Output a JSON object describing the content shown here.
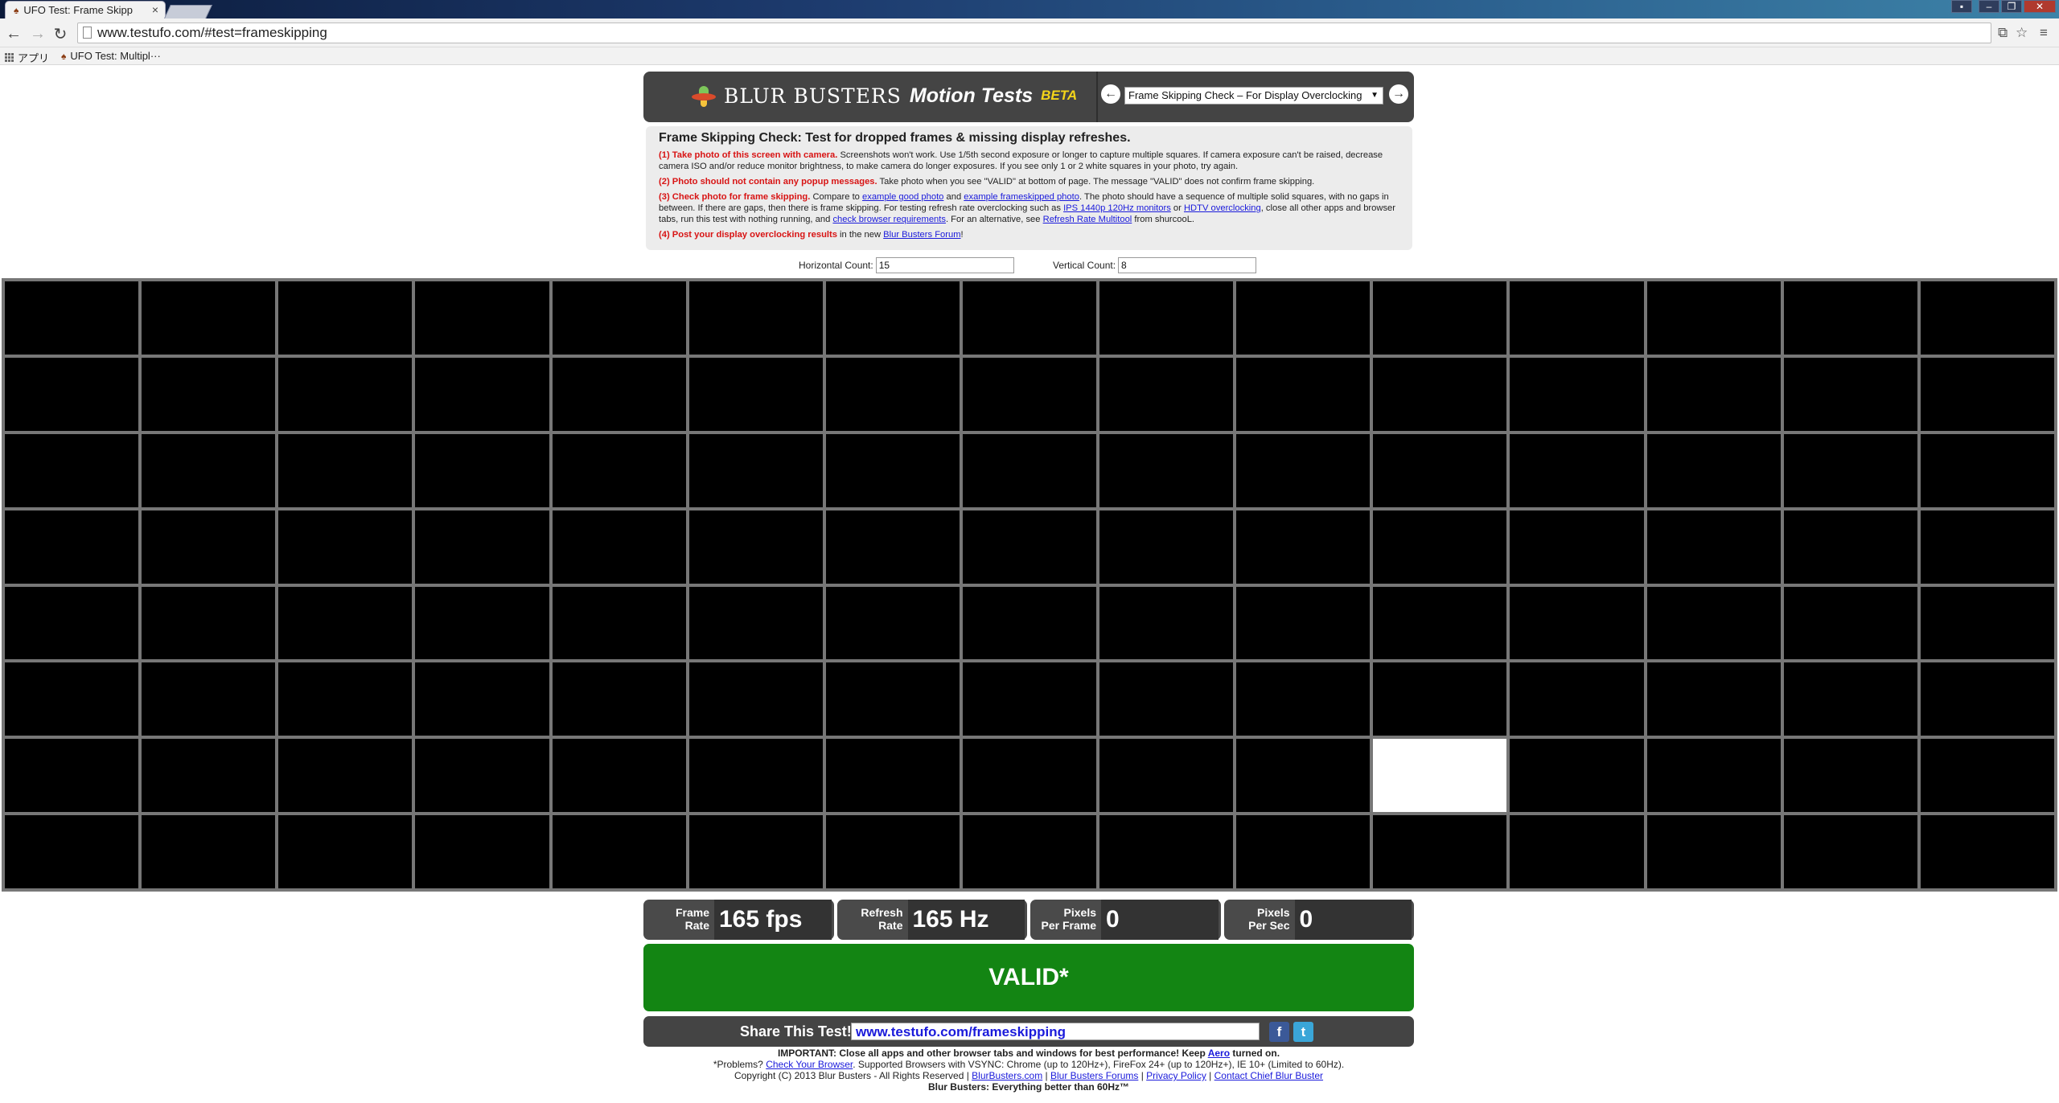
{
  "browser": {
    "tab_title": "UFO Test: Frame Skipp",
    "tab_close": "×",
    "url": "www.testufo.com/#test=frameskipping",
    "back": "←",
    "forward": "→",
    "reload": "↻",
    "bookmarks": [
      {
        "label": "アプリ",
        "icon": "apps-icon"
      },
      {
        "label": "UFO Test: Multipl···",
        "icon": "ufo-favicon"
      }
    ]
  },
  "header": {
    "brand": "BLUR BUSTERS",
    "subtitle": "Motion Tests",
    "beta": "BETA",
    "prev_arrow": "←",
    "next_arrow": "→",
    "selected_test": "Frame Skipping Check – For Display Overclocking"
  },
  "info": {
    "title": "Frame Skipping Check: Test for dropped frames & missing display refreshes.",
    "step1_head": "(1) Take photo of this screen with camera.",
    "step1_text": " Screenshots won't work. Use 1/5th second exposure or longer to capture multiple squares. If camera exposure can't be raised, decrease camera ISO and/or reduce monitor brightness, to make camera do longer exposures. If you see only 1 or 2 white squares in your photo, try again.",
    "step2_head": "(2) Photo should not contain any popup messages.",
    "step2_text": " Take photo when you see \"VALID\" at bottom of page. The message \"VALID\" does not confirm frame skipping.",
    "step3_head": "(3) Check photo for frame skipping.",
    "step3_t1": " Compare to ",
    "step3_l1": "example good photo",
    "step3_t2": " and ",
    "step3_l2": "example frameskipped photo",
    "step3_t3": ". The photo should have a sequence of multiple solid squares, with no gaps in between. If there are gaps, then there is frame skipping. For testing refresh rate overclocking such as ",
    "step3_l3": "IPS 1440p 120Hz monitors",
    "step3_t4": " or ",
    "step3_l4": "HDTV overclocking",
    "step3_t5": ", close all other apps and browser tabs, run this test with nothing running, and ",
    "step3_l5": "check browser requirements",
    "step3_t6": ". For an alternative, see ",
    "step3_l6": "Refresh Rate Multitool",
    "step3_t7": " from shurcooL.",
    "step4_head": "(4) Post your display overclocking results",
    "step4_t1": " in the new ",
    "step4_l1": "Blur Busters Forum",
    "step4_t2": "!"
  },
  "counts": {
    "horizontal_label": "Horizontal Count:",
    "horizontal_value": "15",
    "vertical_label": "Vertical Count:",
    "vertical_value": "8"
  },
  "grid": {
    "columns": 15,
    "rows": 8,
    "lit_cell": {
      "row": 7,
      "col": 11
    }
  },
  "stats": {
    "frame_rate_label1": "Frame",
    "frame_rate_label2": "Rate",
    "frame_rate_value": "165 fps",
    "refresh_rate_label1": "Refresh",
    "refresh_rate_label2": "Rate",
    "refresh_rate_value": "165 Hz",
    "ppf_label1": "Pixels",
    "ppf_label2": "Per Frame",
    "ppf_value": "0",
    "pps_label1": "Pixels",
    "pps_label2": "Per Sec",
    "pps_value": "0"
  },
  "status": "VALID*",
  "status_color": "#138513",
  "share": {
    "label": "Share This Test!",
    "url": "www.testufo.com/frameskipping",
    "facebook": "f",
    "twitter": "t"
  },
  "footer": {
    "important": "IMPORTANT: Close all apps and other browser tabs and windows for best performance! Keep ",
    "aero": "Aero",
    "important_end": " turned on.",
    "problems_pre": "*Problems? ",
    "check_browser": "Check Your Browser",
    "problems_post": ". Supported Browsers with VSYNC: Chrome (up to 120Hz+), FireFox 24+ (up to 120Hz+), IE 10+ (Limited to 60Hz).",
    "copyright": "Copyright (C) 2013 Blur Busters - All Rights Reserved | ",
    "link1": "BlurBusters.com",
    "sep1": " | ",
    "link2": "Blur Busters Forums",
    "sep2": " | ",
    "link3": "Privacy Policy",
    "sep3": " | ",
    "link4": "Contact Chief Blur Buster",
    "tagline": "Blur Busters: Everything better than 60Hz™"
  }
}
